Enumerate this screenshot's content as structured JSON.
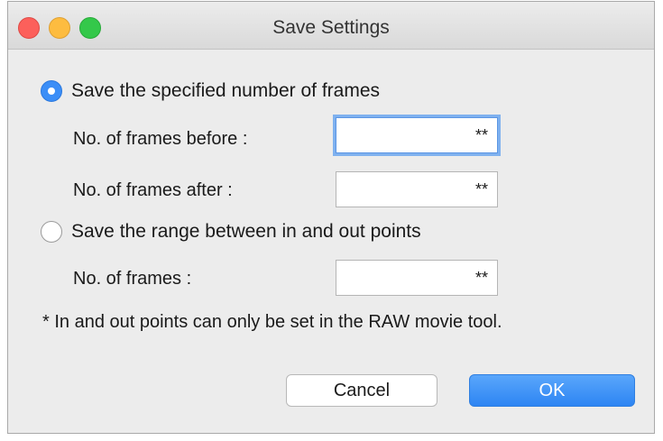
{
  "window": {
    "title": "Save Settings"
  },
  "options": {
    "specified": {
      "label": "Save the specified number of frames",
      "selected": true
    },
    "range": {
      "label": "Save the range between in and out points",
      "selected": false
    }
  },
  "fields": {
    "before": {
      "label": "No. of frames before :",
      "value": "**"
    },
    "after": {
      "label": "No. of frames after :",
      "value": "**"
    },
    "frames": {
      "label": "No. of frames :",
      "value": "**"
    }
  },
  "note": "* In and out points can only be set in the RAW movie tool.",
  "buttons": {
    "cancel": "Cancel",
    "ok": "OK"
  },
  "colors": {
    "accent": "#3b8ef7",
    "close": "#fc605b",
    "minimize": "#fdbc40",
    "maximize": "#34c84a"
  }
}
